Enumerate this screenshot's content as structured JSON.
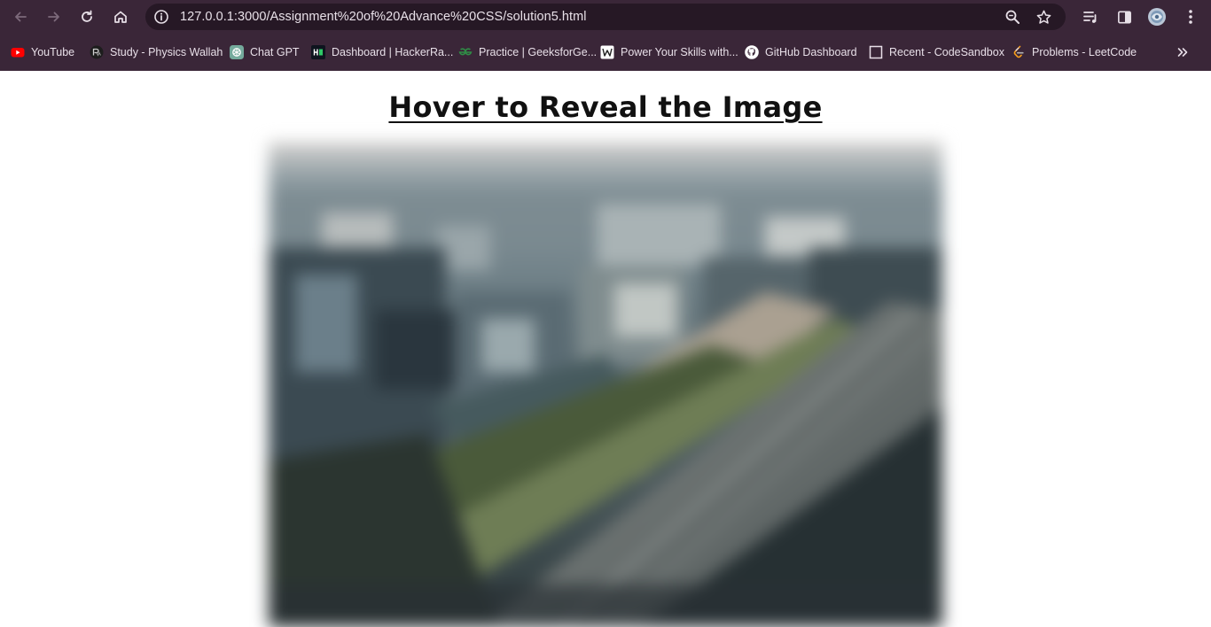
{
  "browser": {
    "url": "127.0.0.1:3000/Assignment%20of%20Advance%20CSS/solution5.html",
    "icons": {
      "back": "arrow-left-icon",
      "forward": "arrow-right-icon",
      "reload": "reload-icon",
      "home": "home-icon",
      "info": "info-icon",
      "zoom": "zoom-icon",
      "bookmark": "star-icon",
      "reading_list": "reading-list-icon",
      "side_panel": "side-panel-icon",
      "profile": "avatar-icon",
      "menu": "kebab-menu-icon"
    }
  },
  "bookmarks": [
    {
      "label": "YouTube",
      "icon": "youtube-icon"
    },
    {
      "label": "Study - Physics Wallah",
      "icon": "physics-wallah-icon"
    },
    {
      "label": "Chat GPT",
      "icon": "chatgpt-icon"
    },
    {
      "label": "Dashboard | HackerRa...",
      "icon": "hackerrank-icon"
    },
    {
      "label": "Practice | GeeksforGe...",
      "icon": "geeksforgeeks-icon"
    },
    {
      "label": "Power Your Skills with...",
      "icon": "site-icon"
    },
    {
      "label": "GitHub Dashboard",
      "icon": "github-icon"
    },
    {
      "label": "Recent - CodeSandbox",
      "icon": "codesandbox-icon"
    },
    {
      "label": "Problems - LeetCode",
      "icon": "leetcode-icon"
    }
  ],
  "page": {
    "title": "Hover to Reveal the Image",
    "image_state": "blurred"
  },
  "colors": {
    "chrome_bg": "#3a2638",
    "omnibox_bg": "#261825",
    "page_bg": "#ffffff",
    "title_color": "#111111"
  }
}
